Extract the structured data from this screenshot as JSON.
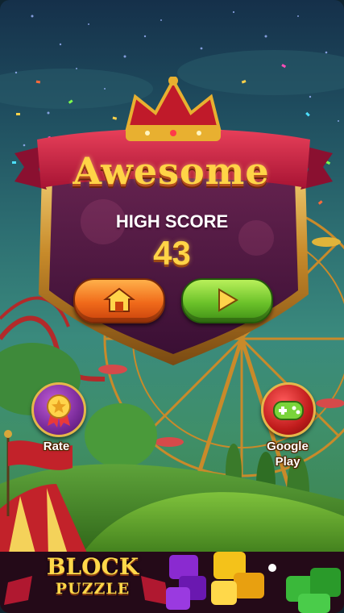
{
  "screen": {
    "title": "Awesome",
    "high_score_label": "HIGH SCORE",
    "high_score_value": "43"
  },
  "buttons": {
    "home_icon": "home-icon",
    "play_icon": "play-icon",
    "rate_label": "Rate",
    "rate_icon": "medal-ribbon-icon",
    "google_play_label_line1": "Google",
    "google_play_label_line2": "Play",
    "google_play_icon": "gamepad-icon"
  },
  "ad_banner": {
    "title": "BLOCK",
    "subtitle": "PUZZLE"
  },
  "colors": {
    "title_gold": "#ffd447",
    "home_button": "#f06a1a",
    "play_button": "#6cc22a",
    "rate_button": "#7a2b9a",
    "google_play_button": "#c01c1c",
    "shield_purple": "#4a1640"
  }
}
